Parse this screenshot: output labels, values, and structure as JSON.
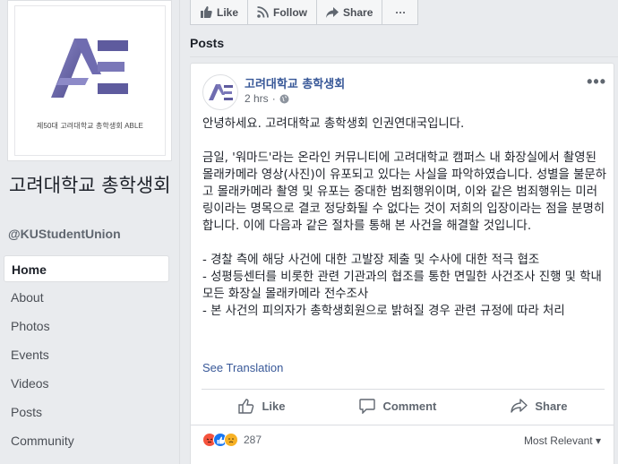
{
  "page": {
    "logo_caption": "제50대 고려대학교 총학생회 ABLE",
    "name": "고려대학교 총학생회",
    "handle": "@KUStudentUnion"
  },
  "nav": {
    "items": [
      {
        "label": "Home",
        "active": true
      },
      {
        "label": "About"
      },
      {
        "label": "Photos"
      },
      {
        "label": "Events"
      },
      {
        "label": "Videos"
      },
      {
        "label": "Posts"
      },
      {
        "label": "Community"
      }
    ]
  },
  "action_bar": {
    "like": "Like",
    "follow": "Follow",
    "share": "Share",
    "more": "···"
  },
  "posts_heading": "Posts",
  "post": {
    "author": "고려대학교 총학생회",
    "time": "2 hrs",
    "dot": "·",
    "more": "•••",
    "paragraph1": "안녕하세요. 고려대학교 총학생회 인권연대국입니다.",
    "paragraph2": "금일, '워마드'라는 온라인 커뮤니티에 고려대학교 캠퍼스 내 화장실에서 촬영된 몰래카메라 영상(사진)이 유포되고 있다는 사실을 파악하였습니다. 성별을 불문하고 몰래카메라 촬영 및 유포는 중대한 범죄행위이며, 이와 같은 범죄행위는 미러링이라는 명목으로 결코 정당화될 수 없다는 것이 저희의 입장이라는 점을 분명히 합니다. 이에 다음과 같은 절차를 통해 본 사건을 해결할 것입니다.",
    "bullet1": "- 경찰 측에 해당 사건에 대한 고발장 제출 및 수사에 대한 적극 협조",
    "bullet2": "- 성평등센터를 비롯한 관련 기관과의 협조를 통한 면밀한 사건조사 진행 및 학내 모든 화장실 몰래카메라 전수조사",
    "bullet3": "- 본 사건의 피의자가 총학생회원으로 밝혀질 경우 관련 규정에 따라 처리",
    "see_translation": "See Translation",
    "actions": {
      "like": "Like",
      "comment": "Comment",
      "share": "Share"
    },
    "reaction_count": "287",
    "sort": "Most Relevant ▾"
  },
  "colors": {
    "link": "#385898",
    "background": "#e9ebee",
    "logo_purple": "#5e5b9e"
  }
}
